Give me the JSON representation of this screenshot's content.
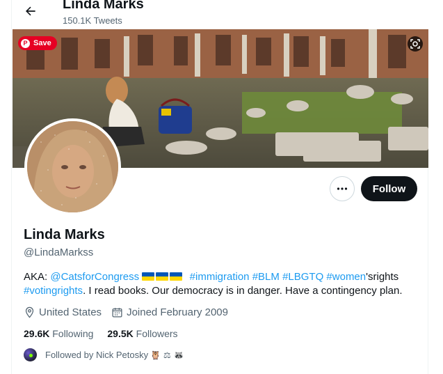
{
  "header": {
    "name": "Linda Marks",
    "tweet_count": "150.1K Tweets",
    "back_icon": "arrow-left-icon"
  },
  "banner": {
    "save_label": "Save",
    "save_icon": "pinterest-icon",
    "lens_icon": "visual-search-icon"
  },
  "profile": {
    "name": "Linda Marks",
    "handle": "@LindaMarkss",
    "more_icon": "more-dots-icon",
    "follow_label": "Follow"
  },
  "bio": {
    "prefix": "AKA: ",
    "mention": "@CatsforCongress",
    "flags_count": 3,
    "hashtag_1": "#immigration",
    "hashtag_2": "#BLM",
    "hashtag_3": "#LBGTQ",
    "hashtag_4": "#women",
    "hashtag_4_suffix": "'srights",
    "hashtag_5": "#votingrights",
    "text_end": ". I read books.  Our democracy is in danger.  Have a contingency plan."
  },
  "meta": {
    "location": "United States",
    "location_icon": "location-pin-icon",
    "joined": "Joined February 2009",
    "joined_icon": "calendar-icon"
  },
  "stats": {
    "following_count": "29.6K",
    "following_label": "Following",
    "followers_count": "29.5K",
    "followers_label": "Followers"
  },
  "followed_by": {
    "text": "Followed by Nick Petosky",
    "emojis": "🦉 ⚖ 🦝"
  },
  "colors": {
    "link": "#1d9bf0",
    "text_primary": "#0f1419",
    "text_secondary": "#536471",
    "follow_bg": "#0f1419",
    "save_red": "#e60023",
    "ukraine_blue": "#0057b7",
    "ukraine_yellow": "#ffd700"
  }
}
